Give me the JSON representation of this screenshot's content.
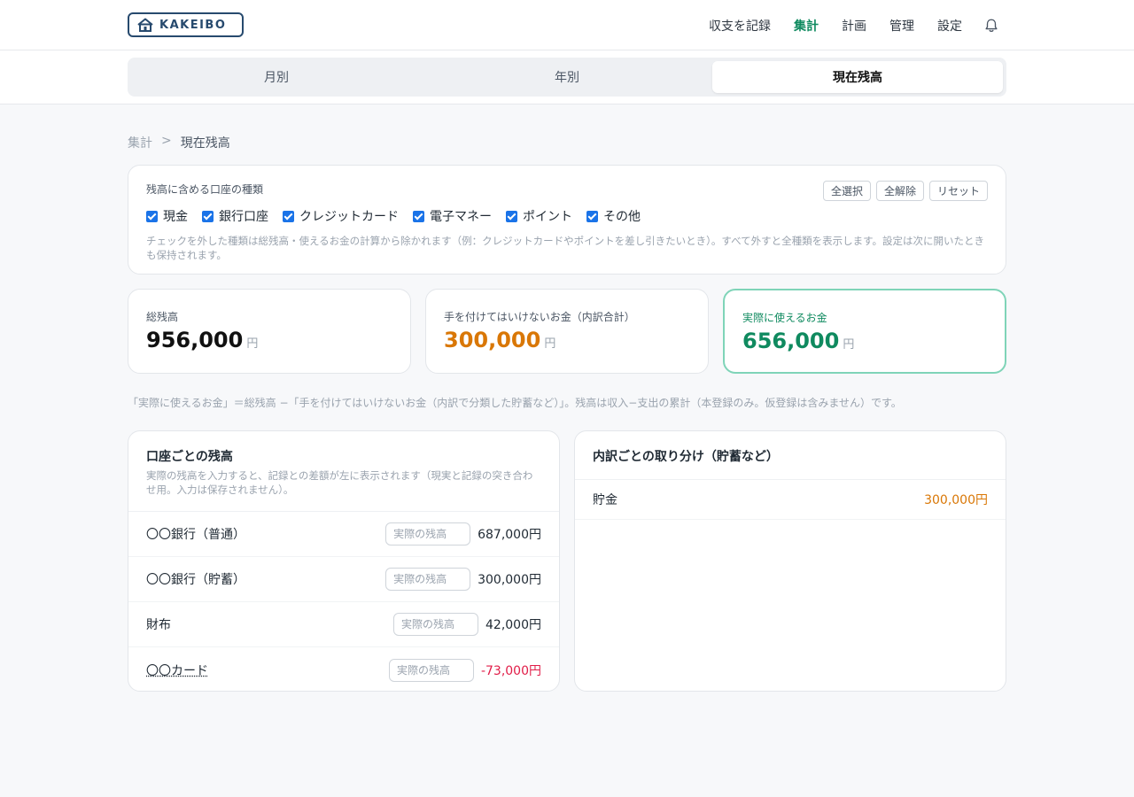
{
  "header": {
    "logo_text": "KAKEIBO",
    "nav": [
      {
        "label": "収支を記録",
        "active": false
      },
      {
        "label": "集計",
        "active": true
      },
      {
        "label": "計画",
        "active": false
      },
      {
        "label": "管理",
        "active": false
      },
      {
        "label": "設定",
        "active": false
      }
    ],
    "bell_icon": "bell-icon",
    "accent_color": "#0f8a5f"
  },
  "tabs": [
    {
      "label": "月別",
      "active": false
    },
    {
      "label": "年別",
      "active": false
    },
    {
      "label": "現在残高",
      "active": true
    }
  ],
  "breadcrumb": {
    "parent": "集計",
    "separator": ">",
    "current": "現在残高"
  },
  "filter": {
    "title": "残高に含める口座の種類",
    "buttons": [
      "全選択",
      "全解除",
      "リセット"
    ],
    "types": [
      {
        "label": "現金",
        "checked": true
      },
      {
        "label": "銀行口座",
        "checked": true
      },
      {
        "label": "クレジットカード",
        "checked": true
      },
      {
        "label": "電子マネー",
        "checked": true
      },
      {
        "label": "ポイント",
        "checked": true
      },
      {
        "label": "その他",
        "checked": true
      }
    ],
    "note": "チェックを外した種類は総残高・使えるお金の計算から除かれます（例：クレジットカードやポイントを差し引きたいとき）。すべて外すと全種類を表示します。設定は次に開いたときも保持されます。"
  },
  "stats": [
    {
      "label": "総残高",
      "value": "956,000",
      "unit": "円"
    },
    {
      "label": "手を付けてはいけないお金（内訳合計）",
      "value": "300,000",
      "unit": "円"
    },
    {
      "label": "実際に使えるお金",
      "value": "656,000",
      "unit": "円"
    }
  ],
  "formula": "「実際に使えるお金」＝総残高 −「手を付けてはいけないお金（内訳で分類した貯蓄など）」。残高は収入−支出の累計（本登録のみ。仮登録は含みません）です。",
  "accounts": {
    "title": "口座ごとの残高",
    "subtitle": "実際の残高を入力すると、記録との差額が左に表示されます（現実と記録の突き合わせ用。入力は保存されません）。",
    "input_placeholder": "実際の残高",
    "rows": [
      {
        "name": "〇〇銀行（普通）",
        "amount": "687,000円",
        "negative": false
      },
      {
        "name": "〇〇銀行（貯蓄）",
        "amount": "300,000円",
        "negative": false
      },
      {
        "name": "財布",
        "amount": "42,000円",
        "negative": false
      },
      {
        "name": "〇〇カード",
        "amount": "-73,000円",
        "negative": true
      }
    ],
    "negative_color": "#e11d48"
  },
  "breakdown": {
    "title": "内訳ごとの取り分け（貯蓄など）",
    "rows": [
      {
        "name": "貯金",
        "amount": "300,000円"
      }
    ],
    "amount_color": "#d97706"
  }
}
